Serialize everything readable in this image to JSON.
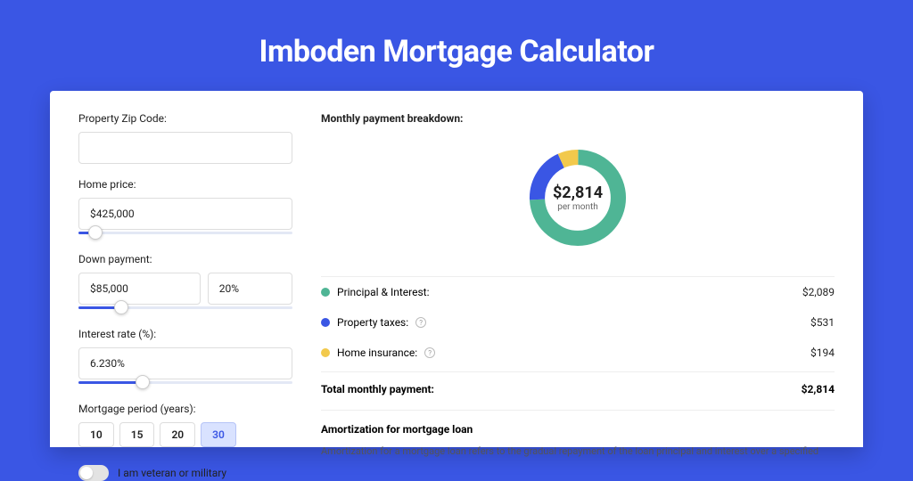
{
  "title": "Imboden Mortgage Calculator",
  "form": {
    "zip_label": "Property Zip Code:",
    "zip_value": "",
    "home_price_label": "Home price:",
    "home_price_value": "$425,000",
    "home_price_slider_pct": 8,
    "down_payment_label": "Down payment:",
    "down_payment_value": "$85,000",
    "down_payment_pct": "20%",
    "down_payment_slider_pct": 20,
    "interest_label": "Interest rate (%):",
    "interest_value": "6.230%",
    "interest_slider_pct": 30,
    "period_label": "Mortgage period (years):",
    "period_options": [
      "10",
      "15",
      "20",
      "30"
    ],
    "period_selected": "30",
    "veteran_label": "I am veteran or military"
  },
  "breakdown": {
    "title": "Monthly payment breakdown:",
    "center_amount": "$2,814",
    "center_sub": "per month",
    "items": [
      {
        "label": "Principal & Interest:",
        "value": "$2,089",
        "color": "green",
        "has_info": false
      },
      {
        "label": "Property taxes:",
        "value": "$531",
        "color": "blue",
        "has_info": true
      },
      {
        "label": "Home insurance:",
        "value": "$194",
        "color": "yellow",
        "has_info": true
      }
    ],
    "total_label": "Total monthly payment:",
    "total_value": "$2,814"
  },
  "amortization": {
    "title": "Amortization for mortgage loan",
    "text": "Amortization for a mortgage loan refers to the gradual repayment of the loan principal and interest over a specified"
  },
  "chart_data": {
    "type": "pie",
    "title": "Monthly payment breakdown",
    "series": [
      {
        "name": "Principal & Interest",
        "value": 2089,
        "color": "#4fb595"
      },
      {
        "name": "Property taxes",
        "value": 531,
        "color": "#3a56e4"
      },
      {
        "name": "Home insurance",
        "value": 194,
        "color": "#f2c94c"
      }
    ],
    "total": 2814,
    "center_label": "$2,814 per month"
  }
}
